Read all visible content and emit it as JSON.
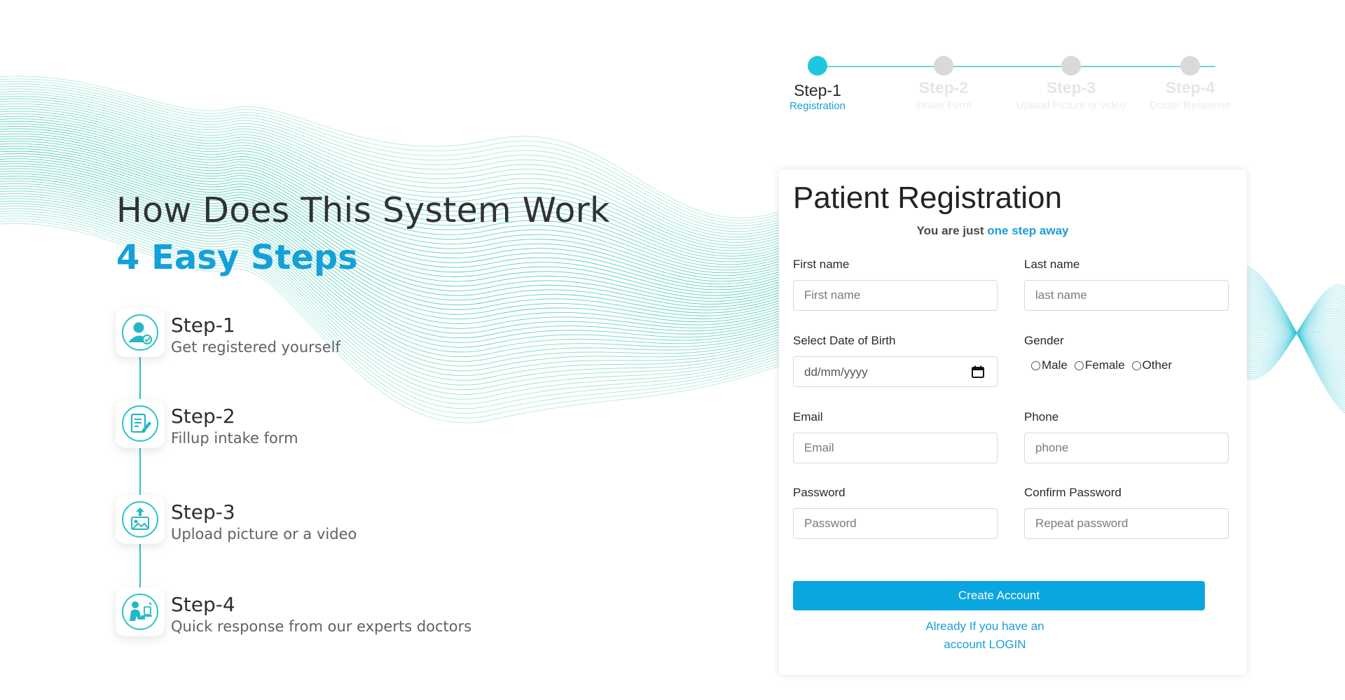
{
  "left": {
    "heading": "How Does This System Work",
    "subheading": "4 Easy Steps",
    "steps": [
      {
        "title": "Step-1",
        "description": "Get registered yourself",
        "icon": "user-check-icon"
      },
      {
        "title": "Step-2",
        "description": "Fillup intake form",
        "icon": "form-edit-icon"
      },
      {
        "title": "Step-3",
        "description": "Upload picture or a video",
        "icon": "upload-picture-icon"
      },
      {
        "title": "Step-4",
        "description": "Quick response from our experts doctors",
        "icon": "doctor-desk-icon"
      }
    ]
  },
  "progress": {
    "steps": [
      {
        "title": "Step-1",
        "subtitle": "Registration",
        "active": true
      },
      {
        "title": "Step-2",
        "subtitle": "Intake Form",
        "active": false
      },
      {
        "title": "Step-3",
        "subtitle": "Upload Picture or video",
        "active": false
      },
      {
        "title": "Step-4",
        "subtitle": "Doctor Response",
        "active": false
      }
    ]
  },
  "form": {
    "title": "Patient Registration",
    "subtitle_prefix": "You are just ",
    "subtitle_accent": "one step away",
    "first_name": {
      "label": "First name",
      "placeholder": "First name"
    },
    "last_name": {
      "label": "Last name",
      "placeholder": "last name"
    },
    "dob": {
      "label": "Select Date of Birth",
      "placeholder": "dd/mm/yyyy"
    },
    "gender": {
      "label": "Gender",
      "options": [
        "Male",
        "Female",
        "Other"
      ]
    },
    "email": {
      "label": "Email",
      "placeholder": "Email"
    },
    "phone": {
      "label": "Phone",
      "placeholder": "phone"
    },
    "password": {
      "label": "Password",
      "placeholder": "Password"
    },
    "confirm_password": {
      "label": "Confirm Password",
      "placeholder": "Repeat password"
    },
    "submit_label": "Create Account",
    "login_link": "Already If you have an account LOGIN"
  },
  "colors": {
    "accent": "#14a0d8",
    "button": "#0aa6e0",
    "teal": "#1cc8dd",
    "wave": "#2ec4a8"
  }
}
